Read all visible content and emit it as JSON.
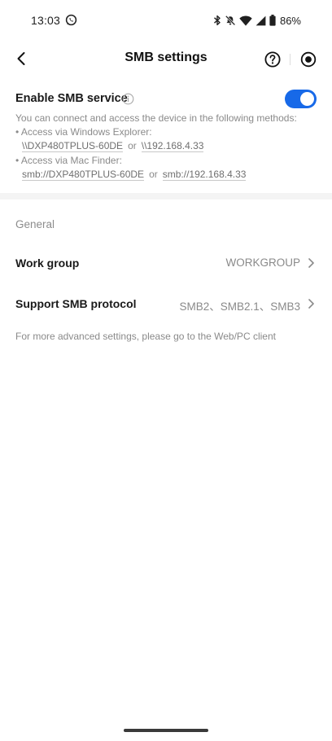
{
  "status_bar": {
    "time": "13:03",
    "left_icons": [
      "whatsapp-icon"
    ],
    "right_icons": [
      "bluetooth-icon",
      "mute-icon",
      "wifi-icon",
      "signal-icon",
      "battery-icon"
    ],
    "battery": "86%"
  },
  "header": {
    "title": "SMB settings",
    "icons": [
      "back-arrow-icon",
      "help-circle-icon",
      "record-circle-icon"
    ]
  },
  "smb": {
    "enable_label": "Enable SMB service",
    "enabled": true,
    "description": "You can connect and access the device in the following methods:",
    "windows": {
      "title": "• Access via Windows Explorer:",
      "host": "\\\\DXP480TPLUS-60DE",
      "or": "or",
      "ip": "\\\\192.168.4.33"
    },
    "mac": {
      "title": "• Access via Mac Finder:",
      "host": "smb://DXP480TPLUS-60DE",
      "or": "or",
      "ip": "smb://192.168.4.33"
    }
  },
  "general": {
    "section_title": "General",
    "rows": [
      {
        "label": "Work group",
        "value": "WORKGROUP"
      },
      {
        "label": "Support SMB protocol",
        "value": "SMB2、SMB2.1、SMB3"
      }
    ],
    "note": "For more advanced settings, please go to the Web/PC client"
  },
  "colors": {
    "accent": "#1769e8",
    "section_bg": "#f4f4f4",
    "secondary_text": "#8a8a8a"
  }
}
